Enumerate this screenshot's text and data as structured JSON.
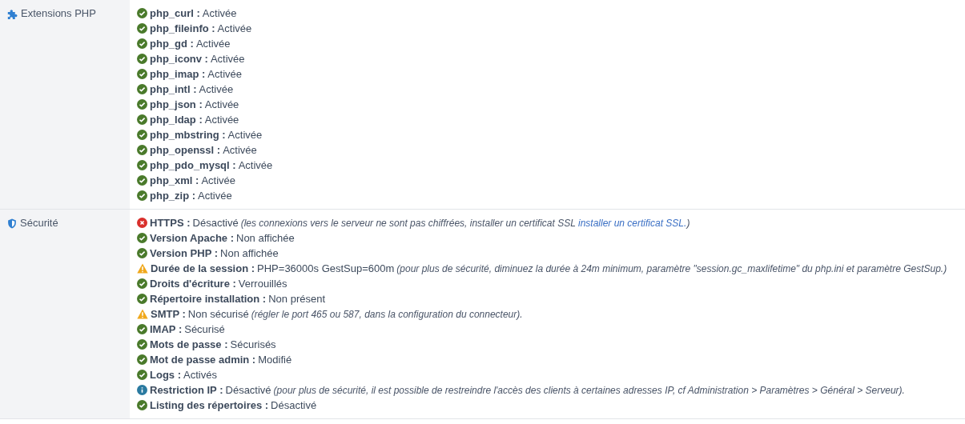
{
  "sections": [
    {
      "title": "Extensions PHP",
      "kind": "puzzle",
      "items": [
        {
          "kind": "ok",
          "label": "php_curl :",
          "value": "Activée"
        },
        {
          "kind": "ok",
          "label": "php_fileinfo :",
          "value": "Activée"
        },
        {
          "kind": "ok",
          "label": "php_gd :",
          "value": "Activée"
        },
        {
          "kind": "ok",
          "label": "php_iconv :",
          "value": "Activée"
        },
        {
          "kind": "ok",
          "label": "php_imap :",
          "value": "Activée"
        },
        {
          "kind": "ok",
          "label": "php_intl :",
          "value": "Activée"
        },
        {
          "kind": "ok",
          "label": "php_json :",
          "value": "Activée"
        },
        {
          "kind": "ok",
          "label": "php_ldap :",
          "value": "Activée"
        },
        {
          "kind": "ok",
          "label": "php_mbstring :",
          "value": "Activée"
        },
        {
          "kind": "ok",
          "label": "php_openssl :",
          "value": "Activée"
        },
        {
          "kind": "ok",
          "label": "php_pdo_mysql :",
          "value": "Activée"
        },
        {
          "kind": "ok",
          "label": "php_xml :",
          "value": "Activée"
        },
        {
          "kind": "ok",
          "label": "php_zip :",
          "value": "Activée"
        }
      ]
    },
    {
      "title": "Sécurité",
      "kind": "shield",
      "items": [
        {
          "kind": "error",
          "label": "HTTPS :",
          "value": "Désactivé",
          "note": "(les connexions vers le serveur ne sont pas chiffrées, installer un certificat SSL",
          "link": "installer un certificat SSL.",
          "note_end": ")"
        },
        {
          "kind": "ok",
          "label": "Version Apache :",
          "value": "Non affichée"
        },
        {
          "kind": "ok",
          "label": "Version PHP :",
          "value": "Non affichée"
        },
        {
          "kind": "warning",
          "label": "Durée de la session :",
          "value": "PHP=36000s GestSup=600m",
          "note": "(pour plus de sécurité, diminuez la durée à 24m minimum, paramètre \"session.gc_maxlifetime\" du php.ini et paramètre GestSup.)"
        },
        {
          "kind": "ok",
          "label": "Droits d'écriture :",
          "value": "Verrouillés"
        },
        {
          "kind": "ok",
          "label": "Répertoire installation :",
          "value": "Non présent"
        },
        {
          "kind": "warning",
          "label": "SMTP :",
          "value": "Non sécurisé",
          "note": "(régler le port 465 ou 587, dans la configuration du connecteur)."
        },
        {
          "kind": "ok",
          "label": "IMAP :",
          "value": "Sécurisé"
        },
        {
          "kind": "ok",
          "label": "Mots de passe :",
          "value": "Sécurisés"
        },
        {
          "kind": "ok",
          "label": "Mot de passe admin :",
          "value": "Modifié"
        },
        {
          "kind": "ok",
          "label": "Logs :",
          "value": "Activés"
        },
        {
          "kind": "info",
          "label": "Restriction IP :",
          "value": "Désactivé",
          "note": "(pour plus de sécurité, il est possible de restreindre l'accès des clients à certaines adresses IP, cf Administration > Paramètres > Général > Serveur)."
        },
        {
          "kind": "ok",
          "label": "Listing des répertoires :",
          "value": "Désactivé"
        }
      ]
    }
  ]
}
